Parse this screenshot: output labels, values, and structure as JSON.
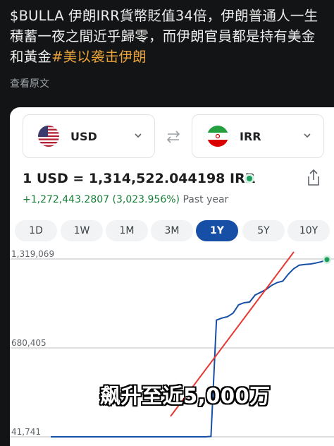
{
  "post": {
    "text": "$BULLA 伊朗IRR貨幣貶值34倍，伊朗普通人一生積蓄一夜之間近乎歸零，而伊朗官員都是持有美金和黃金",
    "hashtag": "#美以袭击伊朗",
    "translate_label": "查看原文"
  },
  "converter": {
    "from": {
      "code": "USD",
      "flag": "us-flag-icon"
    },
    "to": {
      "code": "IRR",
      "flag": "iran-flag-icon"
    },
    "rate_text": "1 USD = 1,314,522.044198 IRR",
    "change_value": "+1,272,443.2807 (3,023.956%)",
    "change_period": "Past year",
    "periods": [
      "1D",
      "1W",
      "1M",
      "3M",
      "1Y",
      "5Y",
      "10Y"
    ],
    "active_period": "1Y",
    "colors": {
      "accent": "#174ea6",
      "line": "#174ea6",
      "positive": "#188038"
    }
  },
  "overlay": {
    "caption": "飙升至近5,000万"
  },
  "chart_data": {
    "type": "line",
    "title": "",
    "xlabel": "",
    "ylabel": "",
    "y_ticks": [
      "1,319,069",
      "680,405",
      "41,741"
    ],
    "y_tick_values": [
      1319069,
      680405,
      41741
    ],
    "ylim": [
      41741,
      1319069
    ],
    "grid": true,
    "series": [
      {
        "values": [
          41741,
          41741,
          41741,
          41741,
          41741,
          41741,
          41741,
          41741,
          41741,
          41741,
          41741,
          41741,
          41741,
          41741,
          41741,
          41741,
          41741,
          41741,
          41741,
          41741,
          41741,
          41741,
          41741,
          41741,
          41741,
          41741,
          41741,
          41741,
          41741,
          45000,
          880000,
          895000,
          905000,
          930000,
          990000,
          1005000,
          1010000,
          1060000,
          1080000,
          1100000,
          1130000,
          1150000,
          1160000,
          1210000,
          1250000,
          1275000,
          1280000,
          1283000,
          1290000,
          1300000,
          1314522
        ]
      }
    ]
  }
}
